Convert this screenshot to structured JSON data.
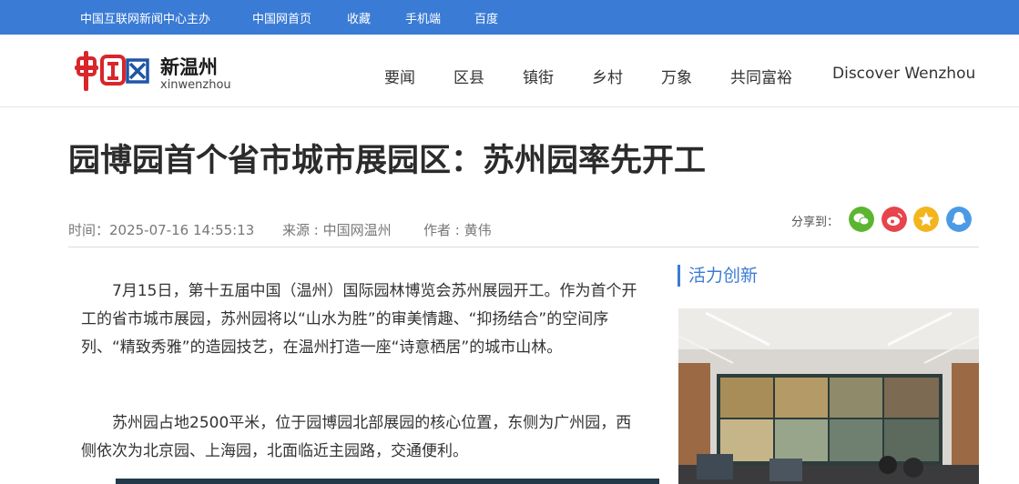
{
  "topbar": {
    "links": [
      "中国互联网新闻中心主办",
      "中国网首页",
      "收藏",
      "手机端",
      "百度"
    ]
  },
  "header": {
    "logo_text": "中国网",
    "site_name": "新温州",
    "site_sub": "xinwenzhou",
    "nav": [
      "要闻",
      "区县",
      "镇街",
      "乡村",
      "万象",
      "共同富裕",
      "Discover Wenzhou"
    ]
  },
  "article": {
    "title": "园博园首个省市城市展园区：苏州园率先开工",
    "time": "时间：2025-07-16 14:55:13",
    "source": "来源 : 中国网温州",
    "author": "作者 : 黄伟",
    "share_label": "分享到：",
    "share": [
      {
        "name": "wechat",
        "color": "#5cb531"
      },
      {
        "name": "weibo",
        "color": "#e6454c"
      },
      {
        "name": "qzone",
        "color": "#f4b51c"
      },
      {
        "name": "qq",
        "color": "#4c9ae6"
      }
    ],
    "paragraphs": [
      "7月15日，第十五届中国（温州）国际园林博览会苏州展园开工。作为首个开工的省市城市展园，苏州园将以“山水为胜”的审美情趣、“抑扬结合”的空间序列、“精致秀雅”的造园技艺，在温州打造一座“诗意栖居”的城市山林。",
      "苏州园占地2500平米，位于园博园北部展园的核心位置，东侧为广州园，西侧依次为北京园、上海园，北面临近主园路，交通便利。"
    ]
  },
  "sidebar": {
    "title": "活力创新"
  }
}
